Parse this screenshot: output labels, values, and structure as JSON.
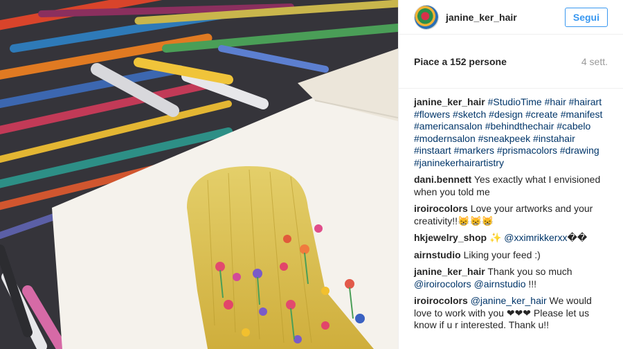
{
  "post": {
    "username": "janine_ker_hair",
    "follow_label": "Segui",
    "likes": "Piace a 152 persone",
    "time_ago": "4 sett."
  },
  "comments": [
    {
      "author": "janine_ker_hair",
      "parts": [
        {
          "t": "#StudioTime",
          "link": true
        },
        {
          "t": " ",
          "link": false
        },
        {
          "t": "#hair",
          "link": true
        },
        {
          "t": " ",
          "link": false
        },
        {
          "t": "#hairart",
          "link": true
        },
        {
          "t": " ",
          "link": false
        },
        {
          "t": "#flowers",
          "link": true
        },
        {
          "t": " ",
          "link": false
        },
        {
          "t": "#sketch",
          "link": true
        },
        {
          "t": " ",
          "link": false
        },
        {
          "t": "#design",
          "link": true
        },
        {
          "t": " ",
          "link": false
        },
        {
          "t": "#create",
          "link": true
        },
        {
          "t": " ",
          "link": false
        },
        {
          "t": "#manifest",
          "link": true
        },
        {
          "t": " ",
          "link": false
        },
        {
          "t": "#americansalon",
          "link": true
        },
        {
          "t": " ",
          "link": false
        },
        {
          "t": "#behindthechair",
          "link": true
        },
        {
          "t": " ",
          "link": false
        },
        {
          "t": "#cabelo",
          "link": true
        },
        {
          "t": " ",
          "link": false
        },
        {
          "t": "#modernsalon",
          "link": true
        },
        {
          "t": " ",
          "link": false
        },
        {
          "t": "#sneakpeek",
          "link": true
        },
        {
          "t": " ",
          "link": false
        },
        {
          "t": "#instahair",
          "link": true
        },
        {
          "t": " ",
          "link": false
        },
        {
          "t": "#instaart",
          "link": true
        },
        {
          "t": " ",
          "link": false
        },
        {
          "t": "#markers",
          "link": true
        },
        {
          "t": " ",
          "link": false
        },
        {
          "t": "#prismacolors",
          "link": true
        },
        {
          "t": " ",
          "link": false
        },
        {
          "t": "#drawing",
          "link": true
        },
        {
          "t": " ",
          "link": false
        },
        {
          "t": "#janinekerhairartistry",
          "link": true
        }
      ]
    },
    {
      "author": "dani.bennett",
      "parts": [
        {
          "t": "Yes exactly what I envisioned when you told me",
          "link": false
        }
      ]
    },
    {
      "author": "iroirocolors",
      "parts": [
        {
          "t": "Love your artworks and your creativity!!😸😸😸",
          "link": false
        }
      ]
    },
    {
      "author": "hkjewelry_shop",
      "parts": [
        {
          "t": "✨",
          "link": false,
          "sparkle": true
        },
        {
          "t": " ",
          "link": false
        },
        {
          "t": "@xximrikkerxx",
          "link": true
        },
        {
          "t": "��",
          "link": false
        }
      ]
    },
    {
      "author": "airnstudio",
      "parts": [
        {
          "t": "Liking your feed :)",
          "link": false
        }
      ]
    },
    {
      "author": "janine_ker_hair",
      "parts": [
        {
          "t": "Thank you so much ",
          "link": false
        },
        {
          "t": "@iroirocolors",
          "link": true
        },
        {
          "t": " ",
          "link": false
        },
        {
          "t": "@airnstudio",
          "link": true
        },
        {
          "t": " !!!",
          "link": false
        }
      ]
    },
    {
      "author": "iroirocolors",
      "parts": [
        {
          "t": "@janine_ker_hair",
          "link": true
        },
        {
          "t": " We would love to work with you ❤❤❤ Please let us know if u r interested. Thank u!!",
          "link": false
        }
      ]
    }
  ],
  "colors": {
    "accent": "#3897f0",
    "link": "#003569",
    "muted": "#999999",
    "text": "#262626"
  },
  "icons": {
    "avatar": "avatar-image"
  }
}
